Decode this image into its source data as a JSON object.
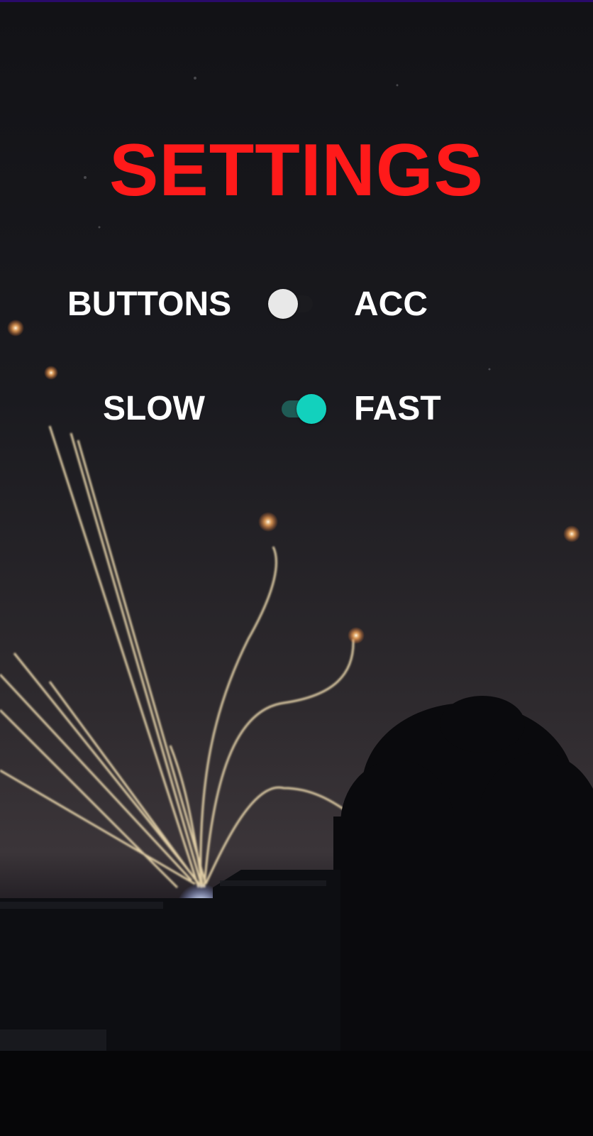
{
  "title": {
    "text": "SETTINGS",
    "color": "#ff1a1a"
  },
  "rows": [
    {
      "left_label": "BUTTONS",
      "right_label": "ACC",
      "switch_checked": false,
      "thumb_color": "#e8e8e8",
      "track_color": "#1b1b1f"
    },
    {
      "left_label": "SLOW",
      "right_label": "FAST",
      "switch_checked": true,
      "thumb_color": "#12d1bd",
      "track_color": "#1f5b55"
    }
  ],
  "background": {
    "description_icon": "night-sky-photo",
    "sky_color": "#1e1e24",
    "ground_color": "#050508"
  }
}
